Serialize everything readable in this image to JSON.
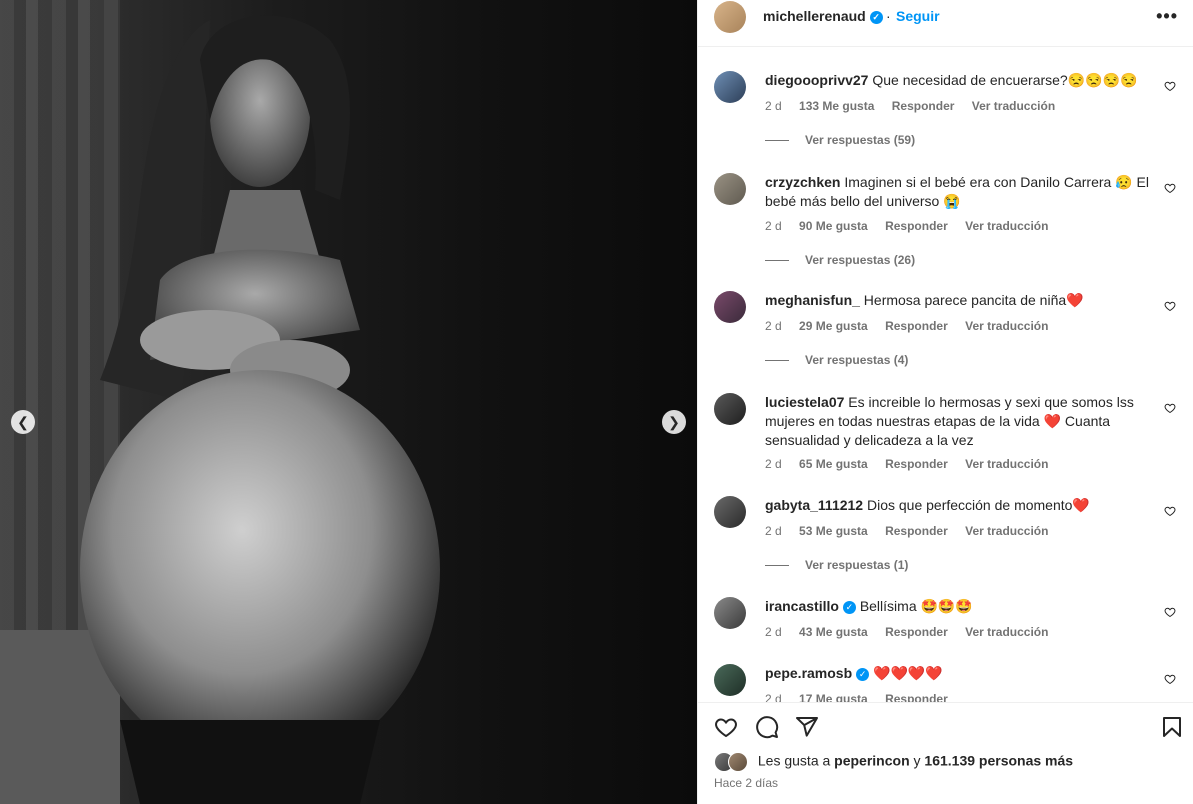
{
  "post": {
    "username": "michellerenaud",
    "separator": "·",
    "follow_label": "Seguir",
    "more_label": "•••"
  },
  "colors": {
    "accent": "#0095f6",
    "text": "#262626",
    "muted": "#737373",
    "heart": "#ed4956"
  },
  "comments": [
    {
      "user": "diegoooprivv27",
      "text": "Que necesidad de encuerarse?😒😒😒😒",
      "time": "2 d",
      "likes": "133 Me gusta",
      "reply": "Responder",
      "translate": "Ver traducción",
      "replies": "Ver respuestas (59)"
    },
    {
      "user": "crzyzchken",
      "text": "Imaginen si el bebé era con Danilo Carrera 😥 El bebé más bello del universo 😭",
      "time": "2 d",
      "likes": "90 Me gusta",
      "reply": "Responder",
      "translate": "Ver traducción",
      "replies": "Ver respuestas (26)"
    },
    {
      "user": "meghanisfun_",
      "text": "Hermosa parece pancita de niña❤️",
      "time": "2 d",
      "likes": "29 Me gusta",
      "reply": "Responder",
      "translate": "Ver traducción",
      "replies": "Ver respuestas (4)"
    },
    {
      "user": "luciestela07",
      "text": "Es increible lo hermosas y sexi que somos lss mujeres en todas nuestras etapas de la vida ❤️ Cuanta sensualidad y delicadeza a la vez",
      "time": "2 d",
      "likes": "65 Me gusta",
      "reply": "Responder",
      "translate": "Ver traducción"
    },
    {
      "user": "gabyta_111212",
      "text": "Dios que perfección de momento❤️",
      "time": "2 d",
      "likes": "53 Me gusta",
      "reply": "Responder",
      "translate": "Ver traducción",
      "replies": "Ver respuestas (1)"
    },
    {
      "user": "irancastillo",
      "text": "Bellísima 🤩🤩🤩",
      "time": "2 d",
      "likes": "43 Me gusta",
      "reply": "Responder",
      "translate": "Ver traducción"
    },
    {
      "user": "pepe.ramosb",
      "text": "❤️❤️❤️❤️",
      "time": "2 d",
      "likes": "17 Me gusta",
      "reply": "Responder"
    }
  ],
  "likes_line": {
    "prefix": "Les gusta a",
    "user": "peperincon",
    "joiner": "y",
    "rest": "161.139 personas más"
  },
  "timestamp": "Hace 2 días",
  "icons": [
    "heart-icon",
    "comment-icon",
    "share-icon",
    "bookmark-icon",
    "chevron-left-icon",
    "chevron-right-icon",
    "verified-icon",
    "more-icon"
  ]
}
